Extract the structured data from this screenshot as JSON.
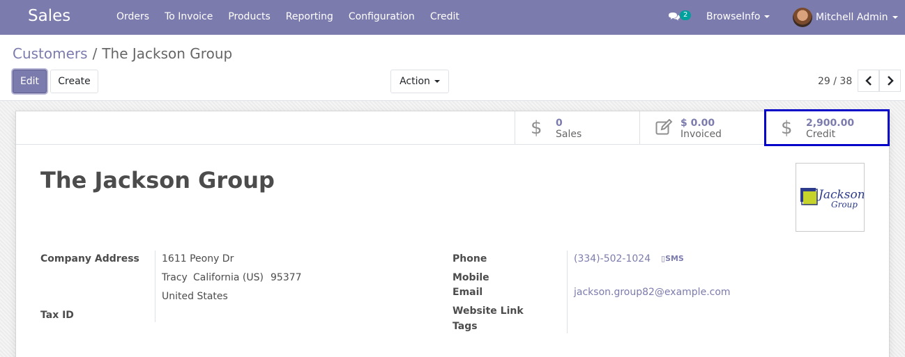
{
  "navbar": {
    "app_name": "Sales",
    "menu": [
      "Orders",
      "To Invoice",
      "Products",
      "Reporting",
      "Configuration",
      "Credit"
    ],
    "chat_count": "2",
    "company": "BrowseInfo",
    "user": "Mitchell Admin",
    "color": "#7c7bad"
  },
  "control_panel": {
    "breadcrumb_parent": "Customers",
    "breadcrumb_separator": "/",
    "breadcrumb_current": "The Jackson Group",
    "edit_label": "Edit",
    "create_label": "Create",
    "action_label": "Action",
    "pager_value": "29 / 38"
  },
  "smart_buttons": [
    {
      "icon": "dollar-icon",
      "value": "0",
      "label": "Sales"
    },
    {
      "icon": "edit-icon",
      "value": "$ 0.00",
      "label": "Invoiced"
    },
    {
      "icon": "dollar-icon",
      "value": "2,900.00",
      "label": "Credit"
    }
  ],
  "partner": {
    "name": "The Jackson Group",
    "logo_text_1": "Jackson",
    "logo_text_2": "Group"
  },
  "fields_left": {
    "address_label": "Company Address",
    "street": "1611 Peony Dr",
    "city": "Tracy",
    "state": "California (US)",
    "zip": "95377",
    "country": "United States",
    "tax_label": "Tax ID"
  },
  "fields_right": {
    "phone_label": "Phone",
    "phone": "(334)-502-1024",
    "sms_label": "SMS",
    "mobile_label": "Mobile",
    "email_label": "Email",
    "email": "jackson.group82@example.com",
    "website_label": "Website Link",
    "tags_label": "Tags"
  }
}
